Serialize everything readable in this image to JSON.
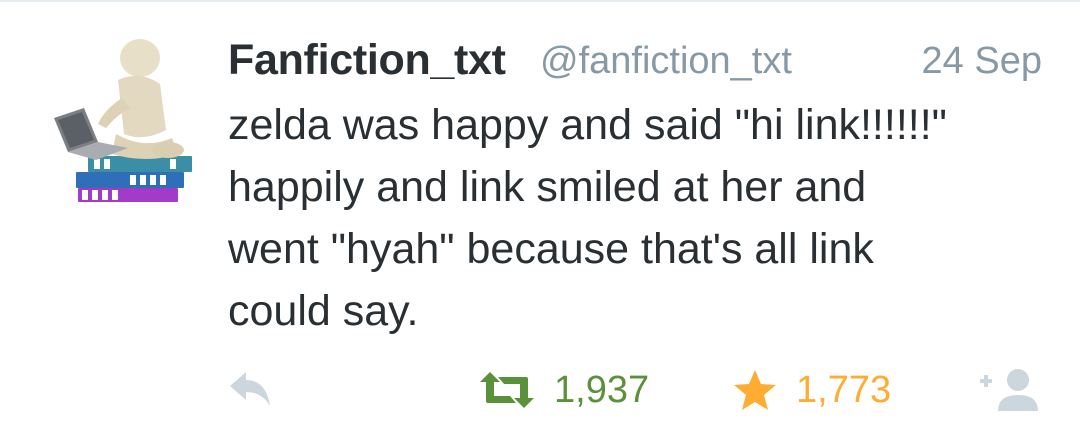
{
  "tweet": {
    "display_name": "Fanfiction_txt",
    "handle": "@fanfiction_txt",
    "timestamp": "24 Sep",
    "text": "zelda was happy and said \"hi link!!!!!!\"\nhappily and link smiled at her and\nwent \"hyah\" because that's all link\ncould say.",
    "avatar_icon": "3d-figure-laptop-books-avatar"
  },
  "actions": {
    "reply_icon": "reply-icon",
    "retweet_icon": "retweet-icon",
    "retweet_count": "1,937",
    "favorite_icon": "star-icon",
    "favorite_count": "1,773",
    "follow_icon": "add-user-icon"
  },
  "colors": {
    "text": "#292f33",
    "muted": "#8899a6",
    "retweet": "#5c913b",
    "favorite": "#ffac33",
    "icon_gray": "#ccd6dd"
  }
}
